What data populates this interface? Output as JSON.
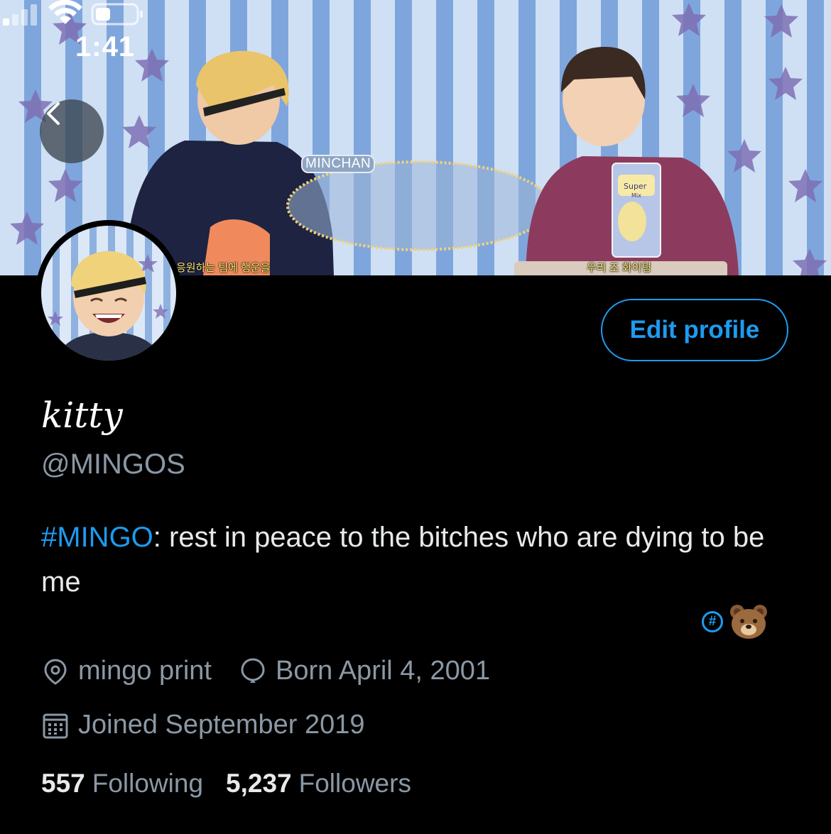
{
  "status_bar": {
    "time": "1:41"
  },
  "header": {
    "banner_tag": "MINCHAN",
    "caption_left": "응원하는 팀에 행운을",
    "caption_right": "우리 조 화이팅",
    "snack_label": "Super",
    "snack_sublabel": "Mix"
  },
  "profile": {
    "edit_profile_label": "Edit profile",
    "display_name": "kitty",
    "handle": "@MINGOS",
    "bio_hashtag": "#MINGO",
    "bio_text": ": rest in peace to the bitches who are dying to be me",
    "translate_badge": "#",
    "location": "mingo print",
    "birthday": "Born April 4, 2001",
    "joined": "Joined September 2019",
    "following_count": "557",
    "following_label": "Following",
    "followers_count": "5,237",
    "followers_label": "Followers"
  },
  "icons": {
    "back": "chevron-left-icon",
    "location": "location-pin-icon",
    "birthday": "balloon-icon",
    "joined": "calendar-icon",
    "emoji": "bear-face-emoji"
  },
  "colors": {
    "accent": "#1d9bf0",
    "background": "#000000",
    "secondary_text": "#8b98a5",
    "primary_text": "#e7e9ea"
  }
}
